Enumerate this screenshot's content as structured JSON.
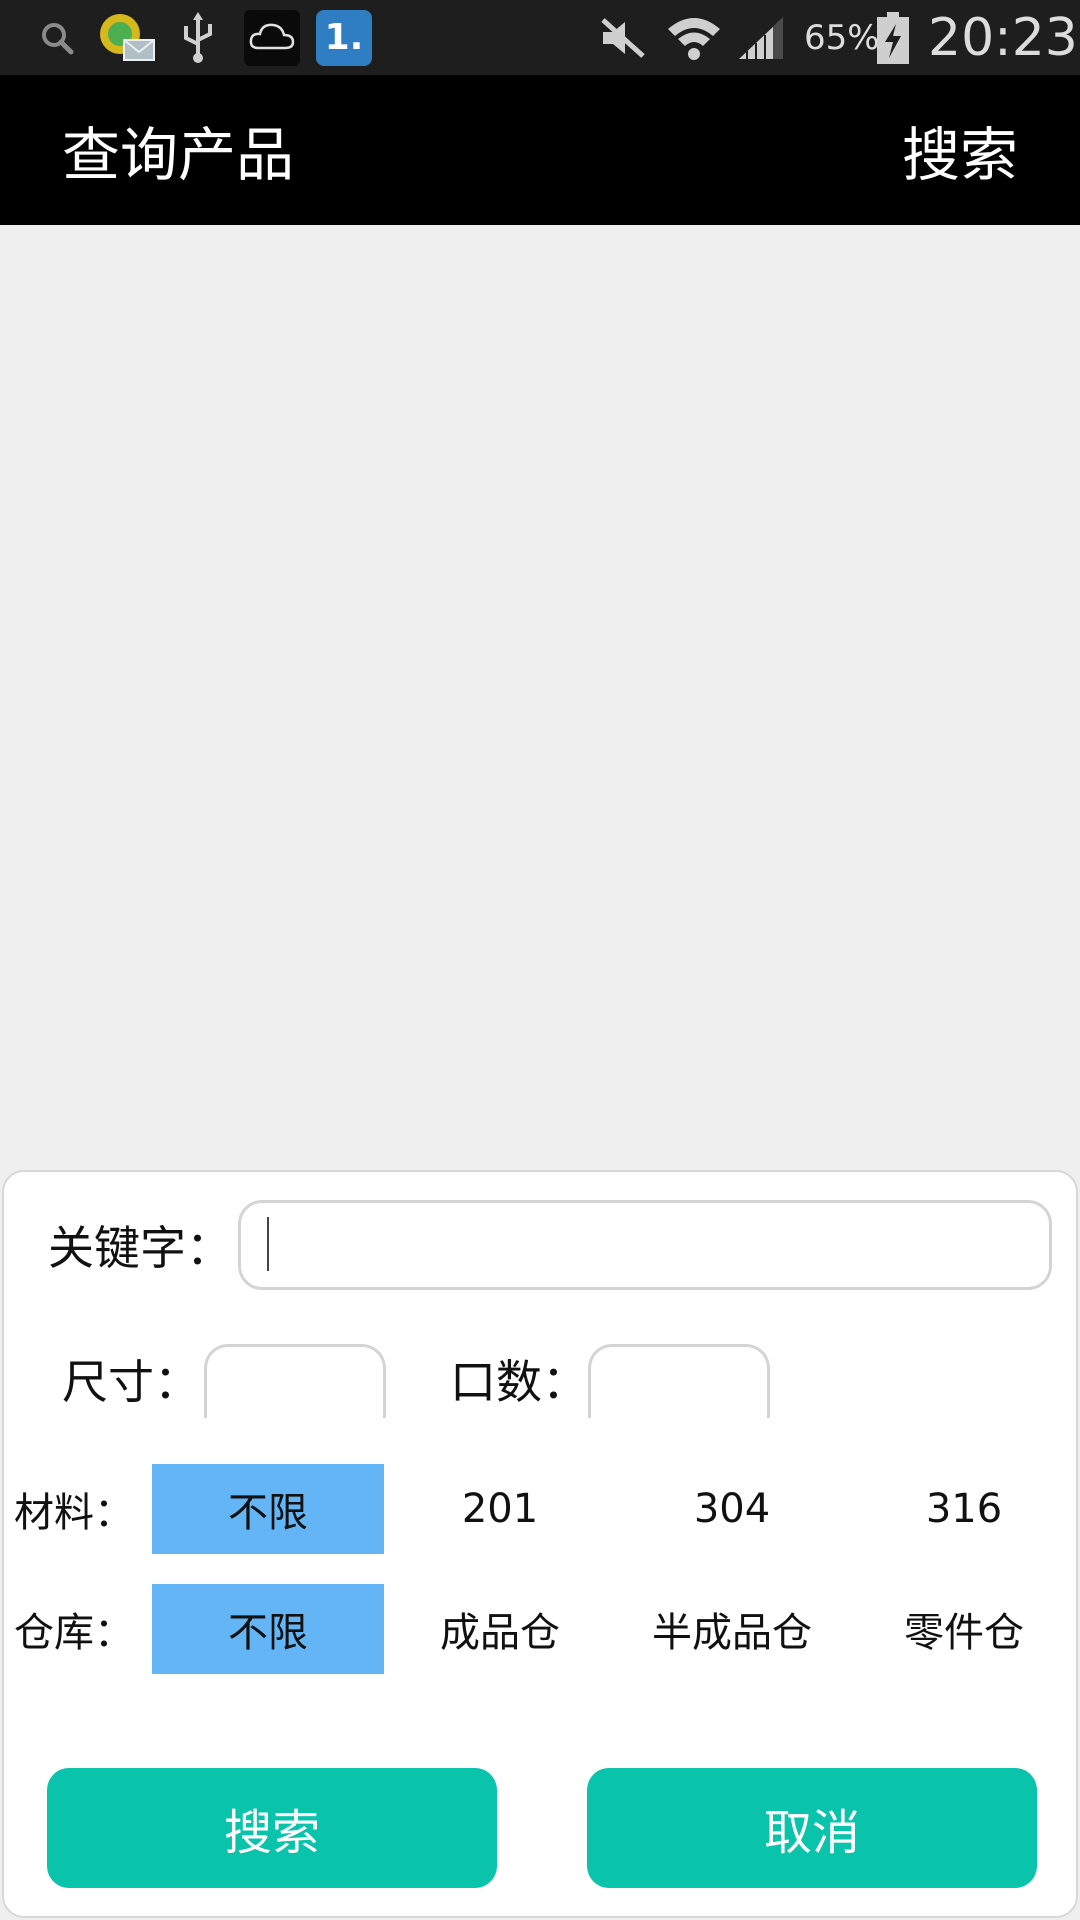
{
  "status_bar": {
    "icons": [
      "search-icon",
      "contacts-mail-icon",
      "usb-icon",
      "cloud-icon",
      "app-badge-icon",
      "mute-icon",
      "wifi-icon",
      "signal-icon",
      "battery-charging-icon"
    ],
    "app_badge_text": "1.",
    "battery": "65%",
    "time": "20:23"
  },
  "header": {
    "title": "查询产品",
    "action": "搜索"
  },
  "form": {
    "keyword_label": "关键字：",
    "keyword_value": "",
    "size_label": "尺寸：",
    "size_value": "",
    "count_label": "口数：",
    "count_value": "",
    "material": {
      "label": "材料：",
      "options": [
        "不限",
        "201",
        "304",
        "316"
      ],
      "selected": "不限"
    },
    "warehouse": {
      "label": "仓库：",
      "options": [
        "不限",
        "成品仓",
        "半成品仓",
        "零件仓"
      ],
      "selected": "不限"
    },
    "search_button": "搜索",
    "cancel_button": "取消"
  },
  "colors": {
    "header_bg": "#000000",
    "selected_option": "#64b5f6",
    "button": "#0ac3ab",
    "content_bg": "#efefef"
  }
}
